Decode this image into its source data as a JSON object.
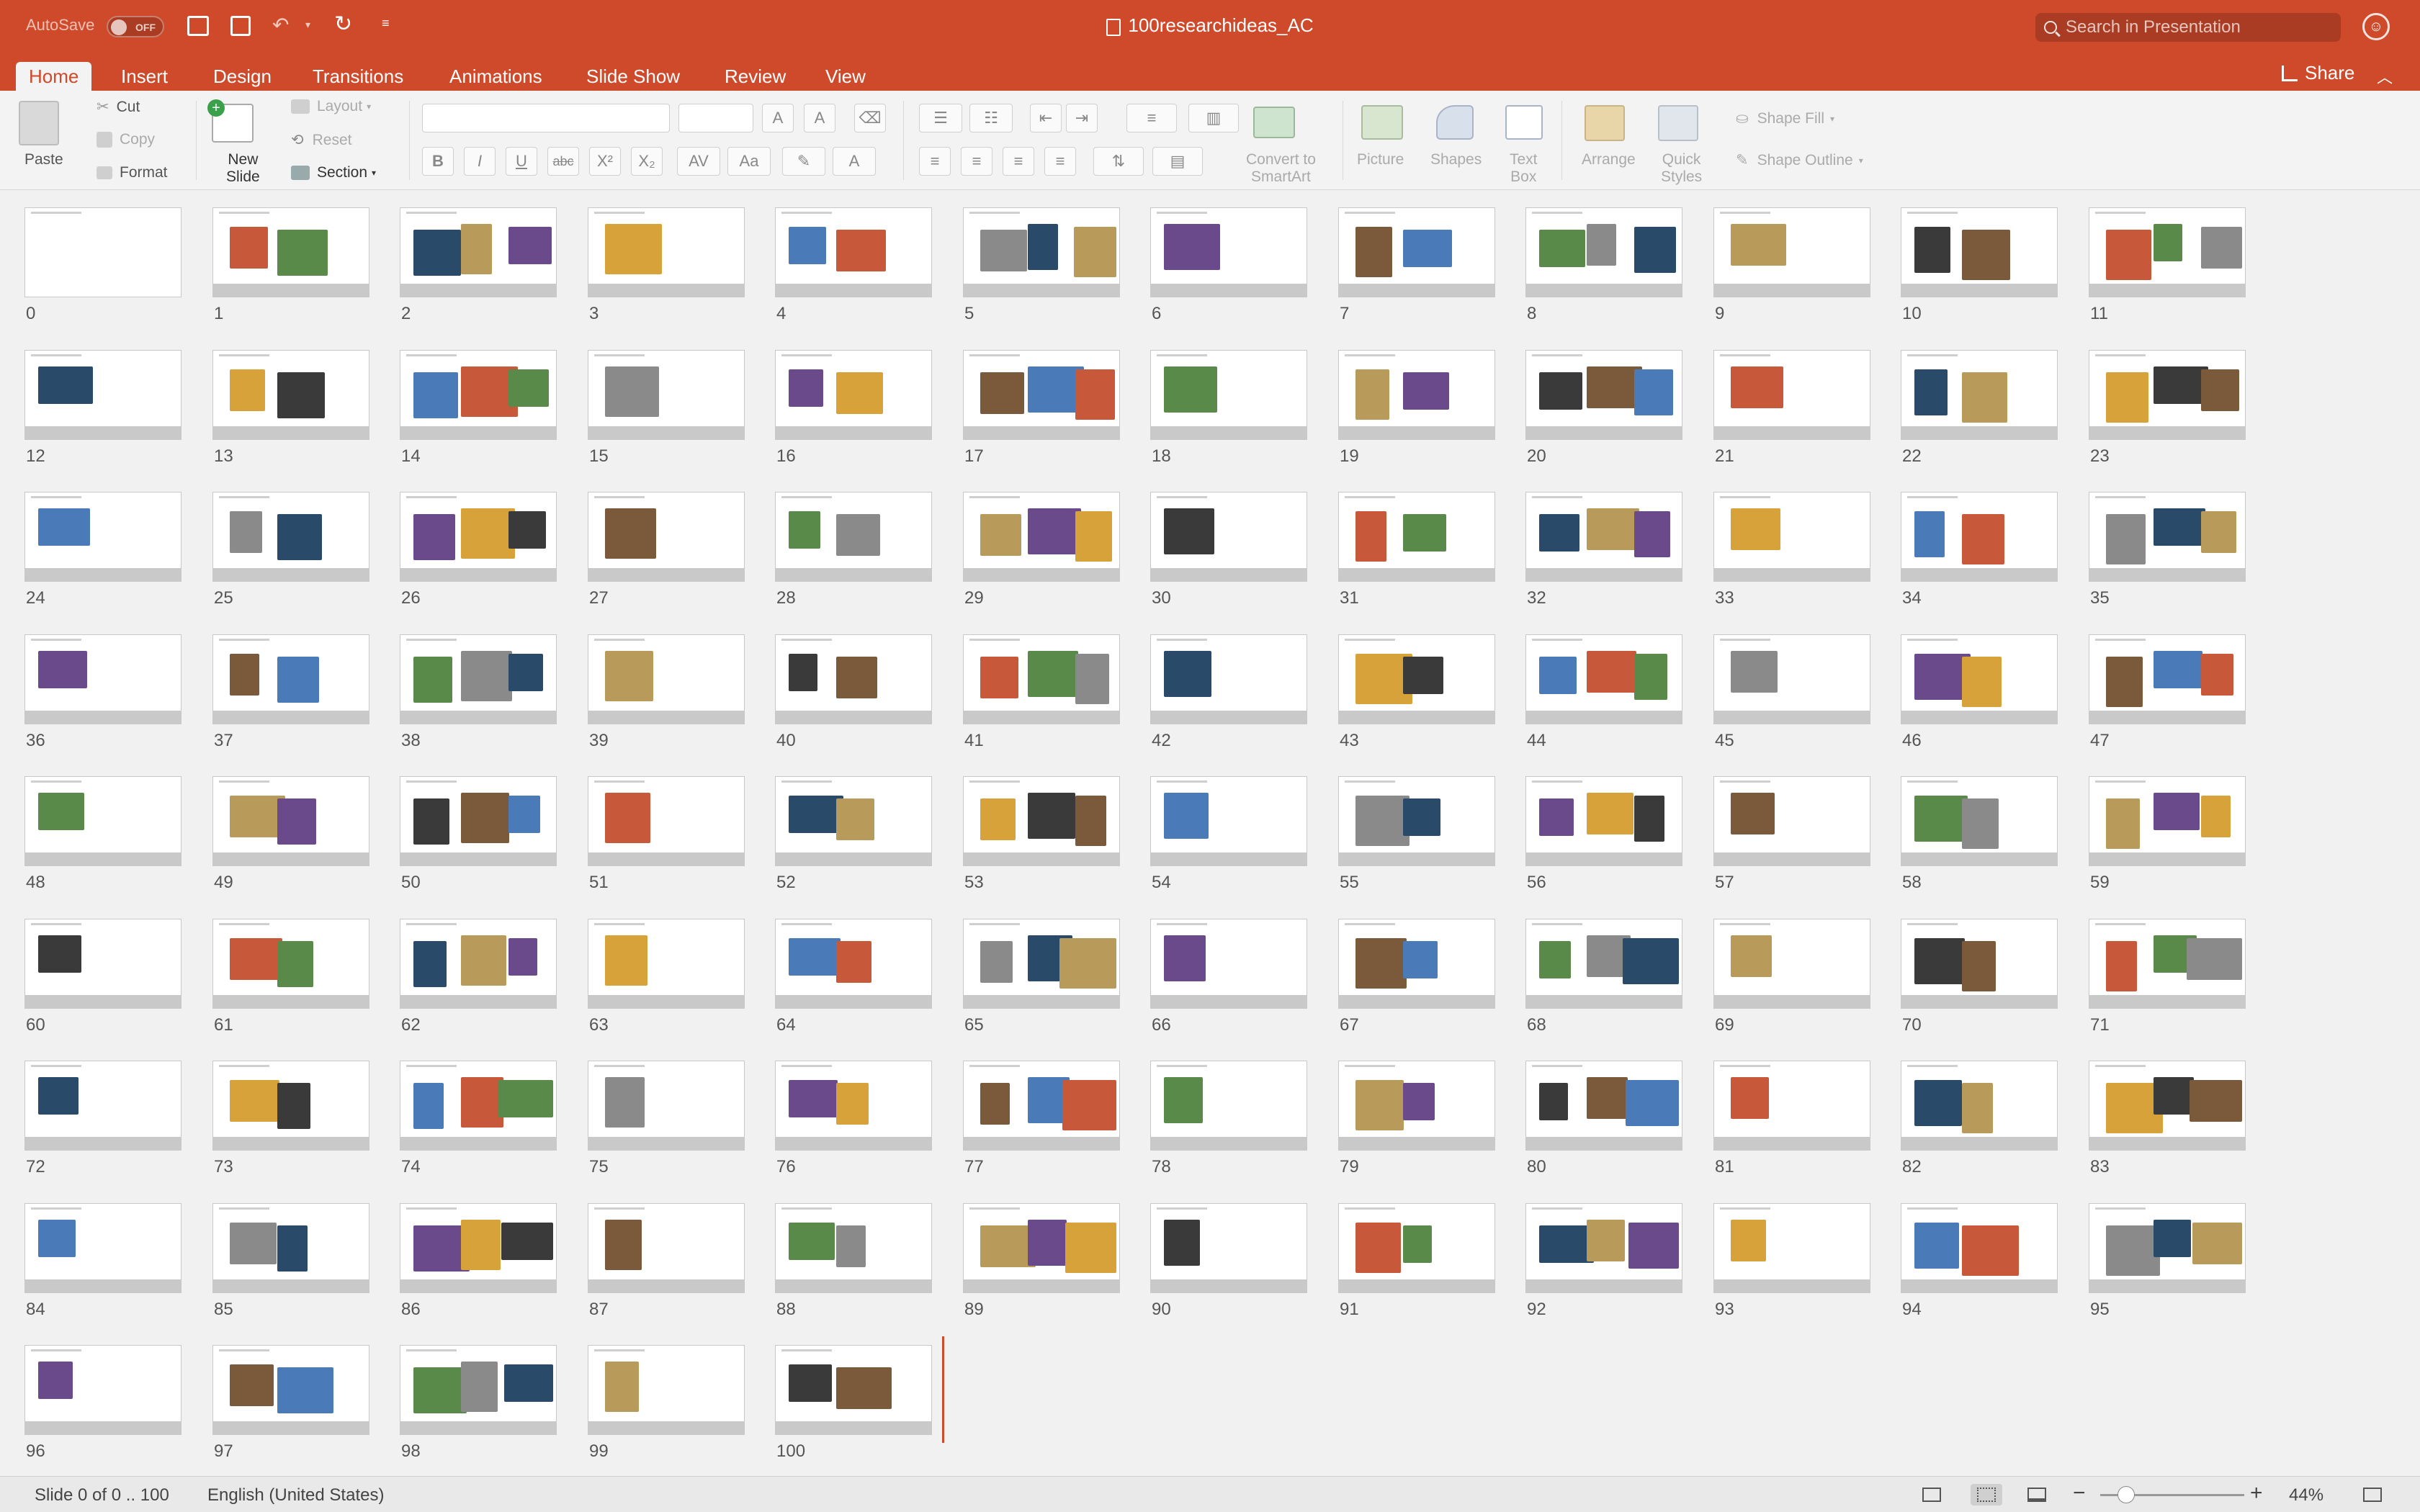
{
  "titlebar": {
    "autosave_label": "AutoSave",
    "autosave_state": "OFF",
    "document_title": "100researchideas_AC",
    "search_placeholder": "Search in Presentation"
  },
  "tabs": [
    "Home",
    "Insert",
    "Design",
    "Transitions",
    "Animations",
    "Slide Show",
    "Review",
    "View"
  ],
  "active_tab": "Home",
  "share_label": "Share",
  "ribbon": {
    "paste": "Paste",
    "cut": "Cut",
    "copy": "Copy",
    "format": "Format",
    "new_slide_1": "New",
    "new_slide_2": "Slide",
    "layout": "Layout",
    "reset": "Reset",
    "section": "Section",
    "convert_1": "Convert to",
    "convert_2": "SmartArt",
    "picture": "Picture",
    "shapes": "Shapes",
    "textbox_1": "Text",
    "textbox_2": "Box",
    "arrange": "Arrange",
    "quick_styles_1": "Quick",
    "quick_styles_2": "Styles",
    "shape_fill": "Shape Fill",
    "shape_outline": "Shape Outline"
  },
  "slide_count": 101,
  "slide_numbers": [
    "0",
    "1",
    "2",
    "3",
    "4",
    "5",
    "6",
    "7",
    "8",
    "9",
    "10",
    "11",
    "12",
    "13",
    "14",
    "15",
    "16",
    "17",
    "18",
    "19",
    "20",
    "21",
    "22",
    "23",
    "24",
    "25",
    "26",
    "27",
    "28",
    "29",
    "30",
    "31",
    "32",
    "33",
    "34",
    "35",
    "36",
    "37",
    "38",
    "39",
    "40",
    "41",
    "42",
    "43",
    "44",
    "45",
    "46",
    "47",
    "48",
    "49",
    "50",
    "51",
    "52",
    "53",
    "54",
    "55",
    "56",
    "57",
    "58",
    "59",
    "60",
    "61",
    "62",
    "63",
    "64",
    "65",
    "66",
    "67",
    "68",
    "69",
    "70",
    "71",
    "72",
    "73",
    "74",
    "75",
    "76",
    "77",
    "78",
    "79",
    "80",
    "81",
    "82",
    "83",
    "84",
    "85",
    "86",
    "87",
    "88",
    "89",
    "90",
    "91",
    "92",
    "93",
    "94",
    "95",
    "96",
    "97",
    "98",
    "99",
    "100"
  ],
  "slide_palette": [
    "#3a3a3a",
    "#7a5a3a",
    "#4a7ab8",
    "#c7583a",
    "#5a8a4a",
    "#8a8a8a",
    "#2a4a6a",
    "#b89a5a",
    "#6a4a8a",
    "#d8a23a"
  ],
  "status": {
    "slide_info": "Slide 0 of 0 .. 100",
    "language": "English (United States)",
    "zoom": "44%"
  }
}
